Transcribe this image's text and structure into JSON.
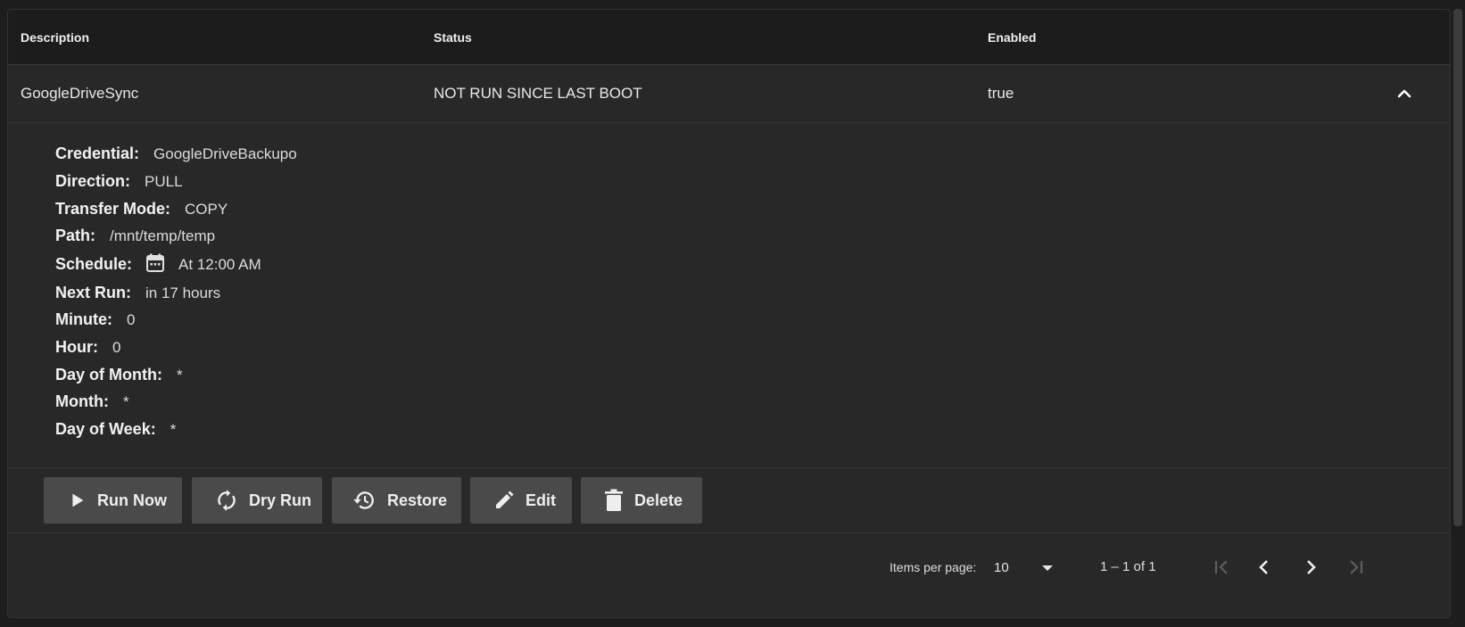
{
  "table": {
    "columns": {
      "description": "Description",
      "status": "Status",
      "enabled": "Enabled"
    },
    "row": {
      "description": "GoogleDriveSync",
      "status": "NOT RUN SINCE LAST BOOT",
      "enabled": "true"
    }
  },
  "details": {
    "credential": {
      "label": "Credential:",
      "value": "GoogleDriveBackupo"
    },
    "direction": {
      "label": "Direction:",
      "value": "PULL"
    },
    "transfer_mode": {
      "label": "Transfer Mode:",
      "value": "COPY"
    },
    "path": {
      "label": "Path:",
      "value": "/mnt/temp/temp"
    },
    "schedule": {
      "label": "Schedule:",
      "value": "At 12:00 AM",
      "icon": "calendar-icon"
    },
    "next_run": {
      "label": "Next Run:",
      "value": "in 17 hours"
    },
    "minute": {
      "label": "Minute:",
      "value": "0"
    },
    "hour": {
      "label": "Hour:",
      "value": "0"
    },
    "day_of_month": {
      "label": "Day of Month:",
      "value": "*"
    },
    "month": {
      "label": "Month:",
      "value": "*"
    },
    "day_of_week": {
      "label": "Day of Week:",
      "value": "*"
    }
  },
  "actions": {
    "run_now": "Run Now",
    "dry_run": "Dry Run",
    "restore": "Restore",
    "edit": "Edit",
    "delete": "Delete"
  },
  "paginator": {
    "items_per_page_label": "Items per page:",
    "page_size": "10",
    "range": "1 – 1 of 1"
  },
  "colors": {
    "background": "#1d1d1d",
    "card": "#282828",
    "header": "#1c1c1c",
    "button": "#4a4a4a",
    "text": "#e6e6e6"
  }
}
